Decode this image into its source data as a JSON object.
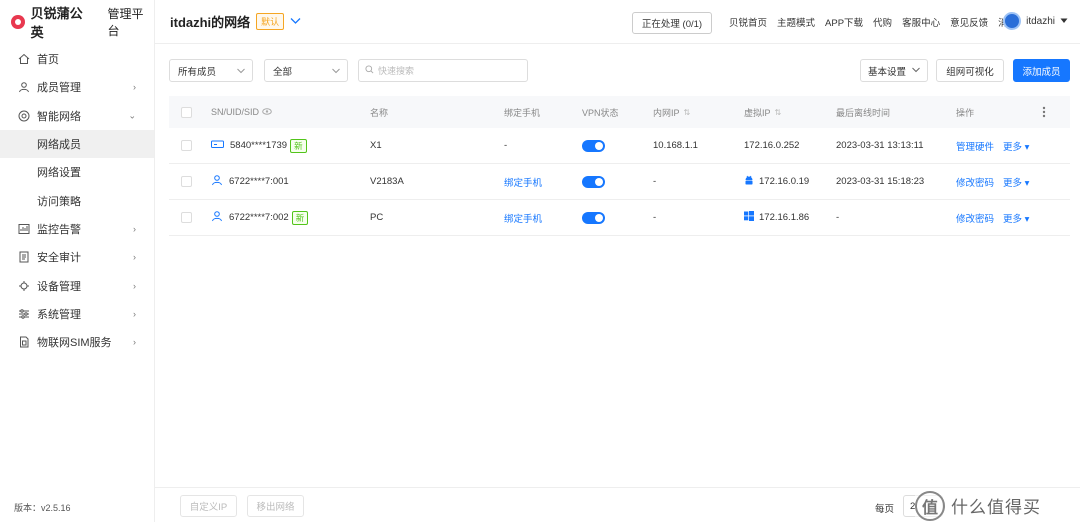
{
  "brand": {
    "name": "贝锐蒲公英",
    "subtitle": "管理平台"
  },
  "sidebar": {
    "items": [
      {
        "label": "首页",
        "icon": "home-icon",
        "has_arrow": false
      },
      {
        "label": "成员管理",
        "icon": "user-icon",
        "has_arrow": true,
        "arrow": "›"
      },
      {
        "label": "智能网络",
        "icon": "network-icon",
        "has_arrow": true,
        "arrow": "⌄"
      },
      {
        "label": "网络成员",
        "sub": true,
        "active": true
      },
      {
        "label": "网络设置",
        "sub": true
      },
      {
        "label": "访问策略",
        "sub": true
      },
      {
        "label": "监控告警",
        "icon": "monitor-icon",
        "has_arrow": true,
        "arrow": "›"
      },
      {
        "label": "安全审计",
        "icon": "audit-icon",
        "has_arrow": true,
        "arrow": "›"
      },
      {
        "label": "设备管理",
        "icon": "device-icon",
        "has_arrow": true,
        "arrow": "›"
      },
      {
        "label": "系统管理",
        "icon": "settings-icon",
        "has_arrow": true,
        "arrow": "›"
      },
      {
        "label": "物联网SIM服务",
        "icon": "sim-icon",
        "has_arrow": true,
        "arrow": "›"
      }
    ],
    "version": "版本：v2.5.16"
  },
  "header": {
    "network_title": "itdazhi的网络",
    "default_badge": "默认",
    "processing": "正在处理 (0/1)",
    "links": [
      "贝锐首页",
      "主题模式",
      "APP下载",
      "代购",
      "客服中心",
      "意见反馈",
      "消息"
    ],
    "username": "itdazhi"
  },
  "toolbar": {
    "member_filter": "所有成员",
    "type_filter": "全部",
    "search_placeholder": "快速搜索",
    "basic_settings": "基本设置",
    "visualize": "组网可视化",
    "add_member": "添加成员"
  },
  "table": {
    "columns": [
      "SN/UID/SID",
      "名称",
      "绑定手机",
      "VPN状态",
      "内网IP",
      "虚拟IP",
      "最后离线时间",
      "操作"
    ],
    "rows": [
      {
        "id": "5840****1739",
        "is_new": true,
        "new_tag": "新",
        "device_icon": "router-icon",
        "name": "X1",
        "phone": "-",
        "phone_link": false,
        "vpn_on": true,
        "lan_ip": "10.168.1.1",
        "virtual_ip": "172.16.0.252",
        "os_icon": "",
        "offline": "2023-03-31 13:13:11",
        "action1": "管理硬件",
        "action2": "更多"
      },
      {
        "id": "6722****7:001",
        "is_new": false,
        "new_tag": "",
        "device_icon": "user-icon",
        "name": "V2183A",
        "phone": "绑定手机",
        "phone_link": true,
        "vpn_on": true,
        "lan_ip": "-",
        "virtual_ip": "172.16.0.19",
        "os_icon": "android-icon",
        "offline": "2023-03-31 15:18:23",
        "action1": "修改密码",
        "action2": "更多"
      },
      {
        "id": "6722****7:002",
        "is_new": true,
        "new_tag": "新",
        "device_icon": "user-icon",
        "name": "PC",
        "phone": "绑定手机",
        "phone_link": true,
        "vpn_on": true,
        "lan_ip": "-",
        "virtual_ip": "172.16.1.86",
        "os_icon": "windows-icon",
        "offline": "-",
        "action1": "修改密码",
        "action2": "更多"
      }
    ]
  },
  "footer": {
    "custom_ip": "自定义IP",
    "remove_network": "移出网络",
    "per_page_label": "每页",
    "page_size": "2"
  },
  "watermark": {
    "text": "什么值得买",
    "mark": "值"
  },
  "colors": {
    "primary": "#1677ff",
    "brand": "#e8384f",
    "new_tag": "#52c41a",
    "badge": "#f5a623"
  }
}
